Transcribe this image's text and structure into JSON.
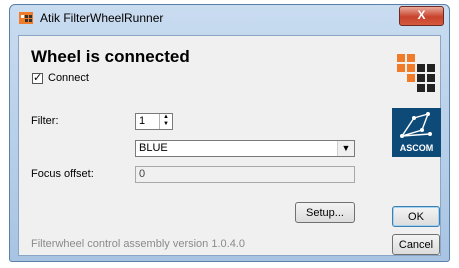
{
  "window": {
    "title": "Atik FilterWheelRunner",
    "close_label": "X"
  },
  "status": {
    "heading": "Wheel is connected"
  },
  "connect": {
    "label": "Connect",
    "checked": true
  },
  "filter": {
    "label": "Filter:",
    "number": "1",
    "selected_name": "BLUE"
  },
  "focus": {
    "label": "Focus offset:",
    "value": "0"
  },
  "buttons": {
    "setup": "Setup...",
    "ok": "OK",
    "cancel": "Cancel"
  },
  "version_text": "Filterwheel control assembly version 1.0.4.0",
  "ascom_logo": {
    "text": "ASCOM"
  },
  "colors": {
    "accent_orange": "#f07c2a",
    "ascom_blue": "#0d4a78"
  }
}
